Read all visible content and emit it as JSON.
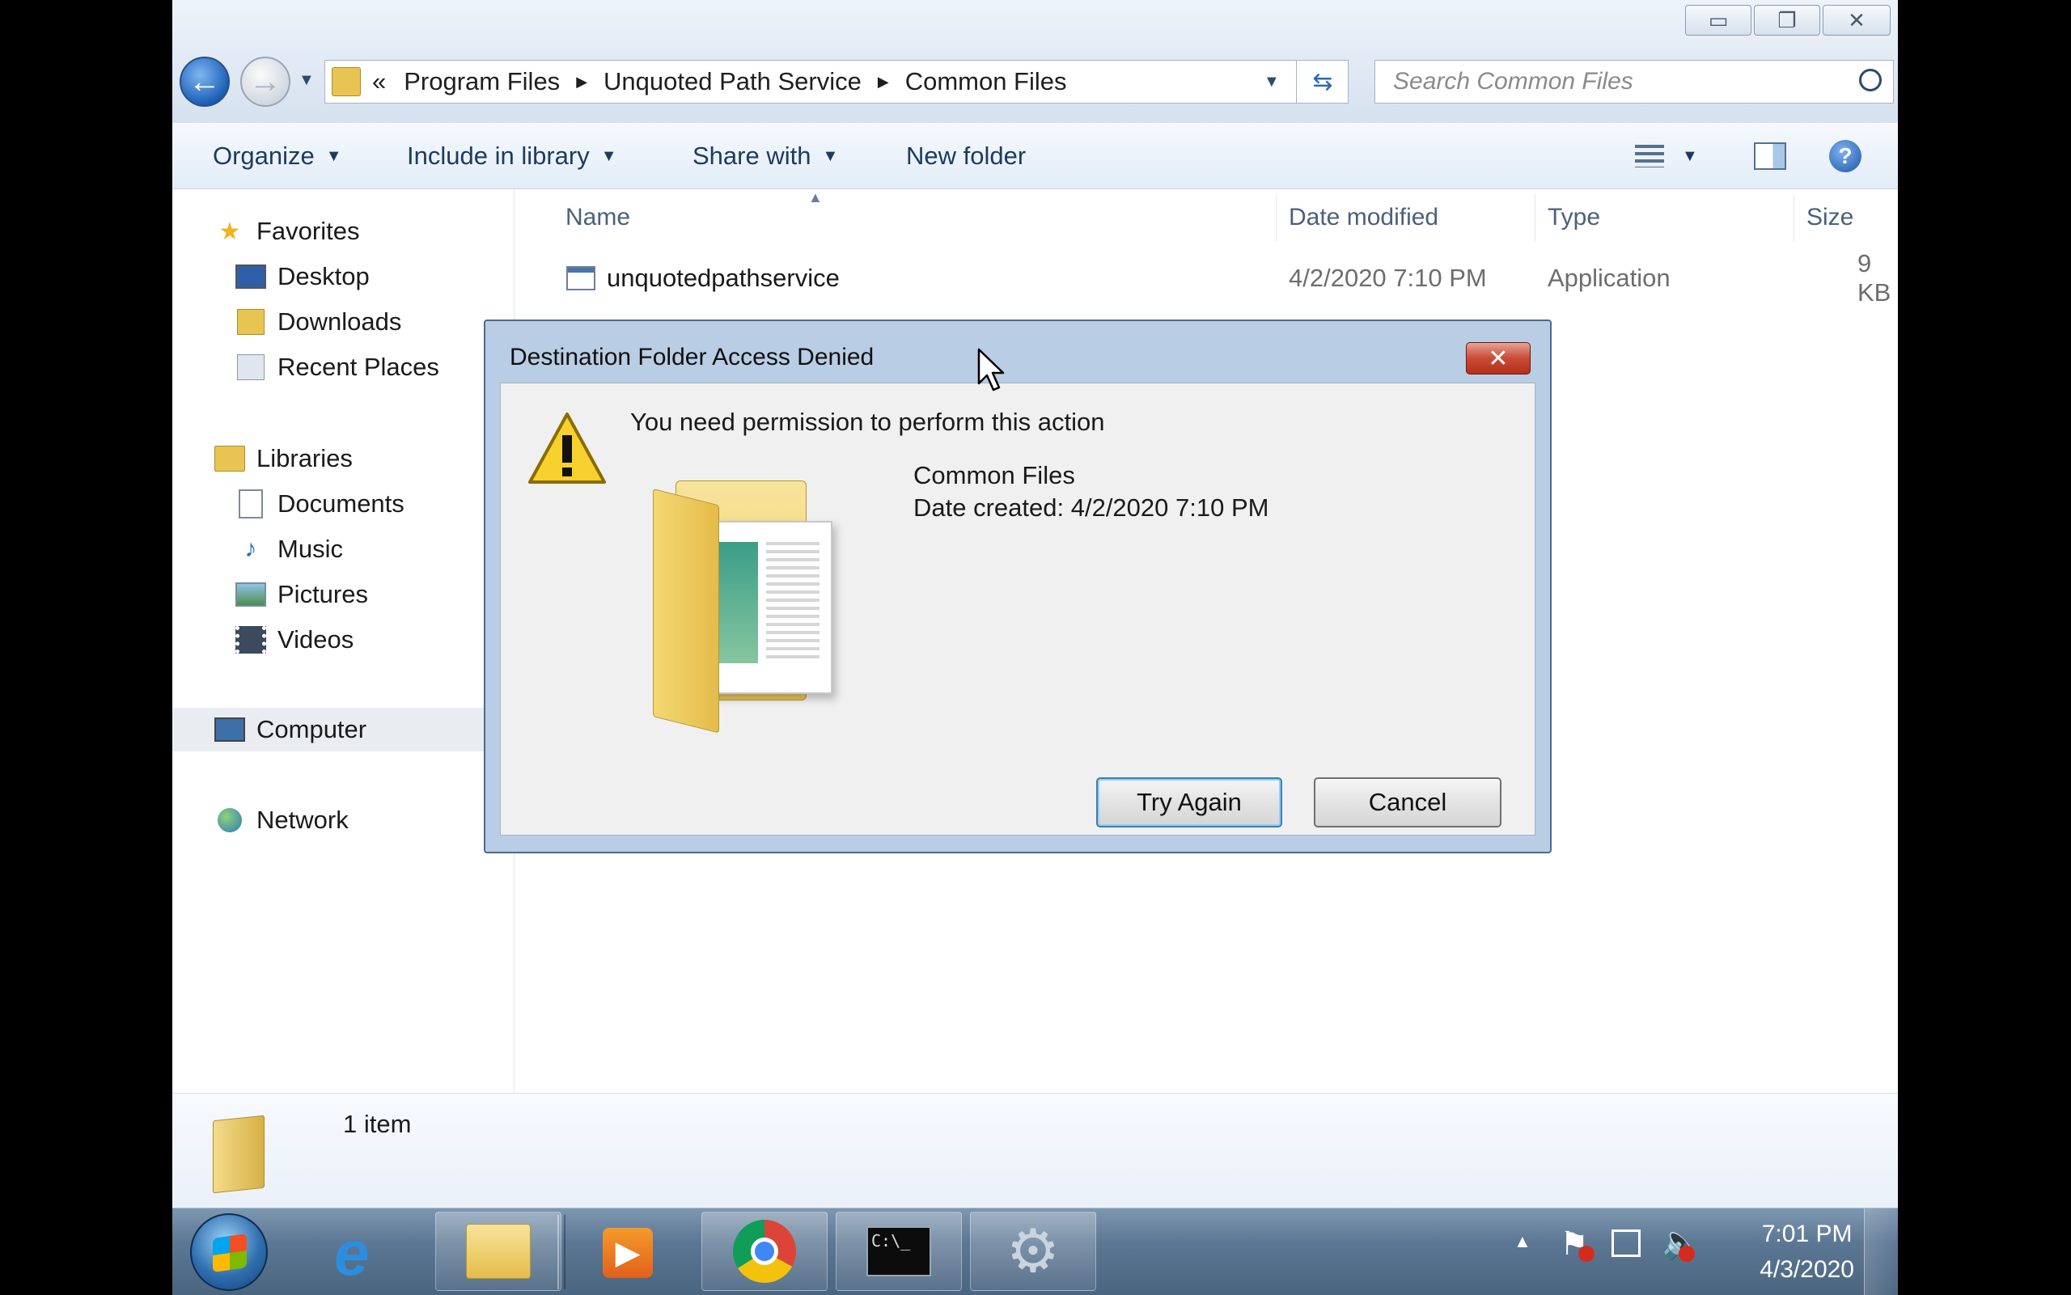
{
  "window": {
    "caption": {
      "minimize": "▭",
      "restore": "❐",
      "close": "✕"
    },
    "address": {
      "overflow": "«",
      "crumbs": [
        "Program Files",
        "Unquoted Path Service",
        "Common Files"
      ],
      "separator": "▶"
    },
    "search": {
      "placeholder": "Search Common Files"
    },
    "toolbar": {
      "organize": "Organize",
      "include": "Include in library",
      "share": "Share with",
      "new_folder": "New folder"
    },
    "nav": {
      "favorites": "Favorites",
      "desktop": "Desktop",
      "downloads": "Downloads",
      "recent": "Recent Places",
      "libraries": "Libraries",
      "documents": "Documents",
      "music": "Music",
      "pictures": "Pictures",
      "videos": "Videos",
      "computer": "Computer",
      "network": "Network"
    },
    "columns": {
      "name": "Name",
      "date": "Date modified",
      "type": "Type",
      "size": "Size"
    },
    "files": [
      {
        "name": "unquotedpathservice",
        "date": "4/2/2020 7:10 PM",
        "type": "Application",
        "size": "9 KB"
      }
    ],
    "status": {
      "count": "1 item"
    }
  },
  "dialog": {
    "title": "Destination Folder Access Denied",
    "close": "✕",
    "message": "You need permission to perform this action",
    "folder_name": "Common Files",
    "date_created": "Date created: 4/2/2020 7:10 PM",
    "try_again": "Try Again",
    "cancel": "Cancel"
  },
  "taskbar": {
    "time": "7:01 PM",
    "date": "4/3/2020",
    "cmd_label": "C:\\_"
  },
  "colors": {
    "accent": "#1e5fb8",
    "close_red": "#c94a35",
    "folder_yellow": "#f2d67a"
  }
}
